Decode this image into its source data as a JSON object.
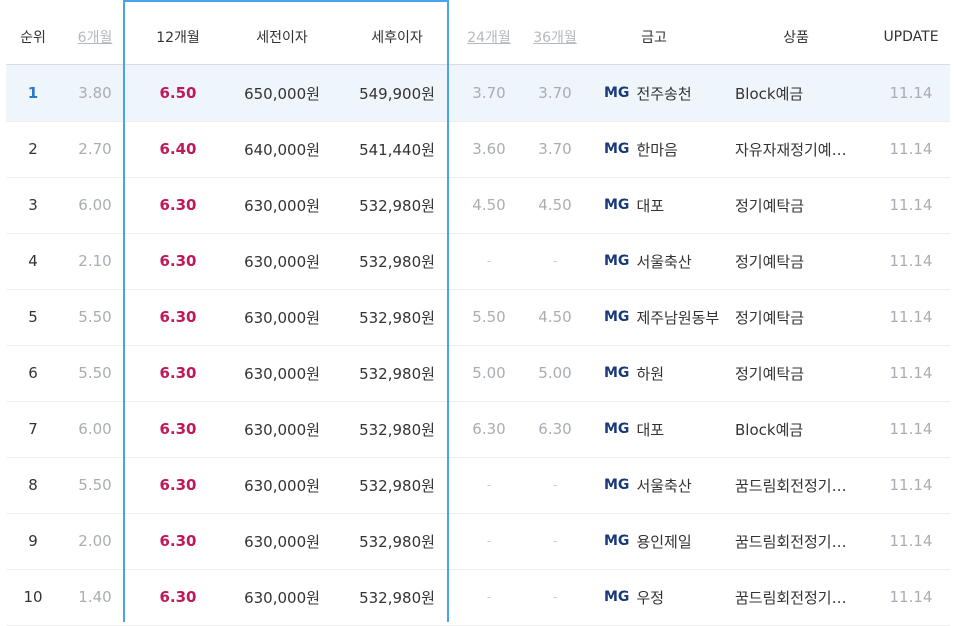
{
  "header": {
    "rank": "순위",
    "m6": "6개월",
    "m12": "12개월",
    "pre_tax": "세전이자",
    "post_tax": "세후이자",
    "m24": "24개월",
    "m36": "36개월",
    "bank": "금고",
    "product": "상품",
    "update": "UPDATE"
  },
  "bank_prefix": "MG",
  "colors": {
    "accent_red": "#c2185b",
    "accent_blue": "#4aa3e8",
    "mg_navy": "#1a3a78"
  },
  "rows": [
    {
      "rank": "1",
      "m6": "3.80",
      "m12": "6.50",
      "pre": "650,000원",
      "post": "549,900원",
      "m24": "3.70",
      "m36": "3.70",
      "bank": "전주송천",
      "product": "Block예금",
      "update": "11.14"
    },
    {
      "rank": "2",
      "m6": "2.70",
      "m12": "6.40",
      "pre": "640,000원",
      "post": "541,440원",
      "m24": "3.60",
      "m36": "3.70",
      "bank": "한마음",
      "product": "자유자재정기예…",
      "update": "11.14"
    },
    {
      "rank": "3",
      "m6": "6.00",
      "m12": "6.30",
      "pre": "630,000원",
      "post": "532,980원",
      "m24": "4.50",
      "m36": "4.50",
      "bank": "대포",
      "product": "정기예탁금",
      "update": "11.14"
    },
    {
      "rank": "4",
      "m6": "2.10",
      "m12": "6.30",
      "pre": "630,000원",
      "post": "532,980원",
      "m24": "-",
      "m36": "-",
      "bank": "서울축산",
      "product": "정기예탁금",
      "update": "11.14"
    },
    {
      "rank": "5",
      "m6": "5.50",
      "m12": "6.30",
      "pre": "630,000원",
      "post": "532,980원",
      "m24": "5.50",
      "m36": "4.50",
      "bank": "제주남원동부",
      "product": "정기예탁금",
      "update": "11.14"
    },
    {
      "rank": "6",
      "m6": "5.50",
      "m12": "6.30",
      "pre": "630,000원",
      "post": "532,980원",
      "m24": "5.00",
      "m36": "5.00",
      "bank": "하원",
      "product": "정기예탁금",
      "update": "11.14"
    },
    {
      "rank": "7",
      "m6": "6.00",
      "m12": "6.30",
      "pre": "630,000원",
      "post": "532,980원",
      "m24": "6.30",
      "m36": "6.30",
      "bank": "대포",
      "product": "Block예금",
      "update": "11.14"
    },
    {
      "rank": "8",
      "m6": "5.50",
      "m12": "6.30",
      "pre": "630,000원",
      "post": "532,980원",
      "m24": "-",
      "m36": "-",
      "bank": "서울축산",
      "product": "꿈드림회전정기…",
      "update": "11.14"
    },
    {
      "rank": "9",
      "m6": "2.00",
      "m12": "6.30",
      "pre": "630,000원",
      "post": "532,980원",
      "m24": "-",
      "m36": "-",
      "bank": "용인제일",
      "product": "꿈드림회전정기…",
      "update": "11.14"
    },
    {
      "rank": "10",
      "m6": "1.40",
      "m12": "6.30",
      "pre": "630,000원",
      "post": "532,980원",
      "m24": "-",
      "m36": "-",
      "bank": "우정",
      "product": "꿈드림회전정기…",
      "update": "11.14"
    }
  ]
}
